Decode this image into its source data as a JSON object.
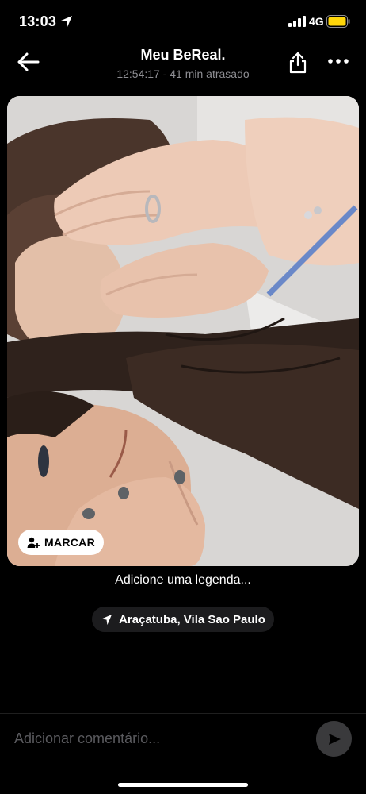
{
  "status_bar": {
    "time": "13:03",
    "network": "4G",
    "battery_color": "#ffd60a",
    "icons": [
      "location-arrow-icon",
      "signal-icon",
      "battery-icon"
    ]
  },
  "header": {
    "title": "Meu BeReal.",
    "subtitle": "12:54:17 - 41 min atrasado",
    "icons": [
      "back-arrow-icon",
      "share-icon",
      "more-icon"
    ]
  },
  "photo": {
    "tag_button_label": "MARCAR",
    "tag_icon": "add-person-icon"
  },
  "caption_placeholder": "Adicione uma legenda...",
  "location": {
    "label": "Araçatuba, Vila Sao Paulo",
    "icon": "location-arrow-icon"
  },
  "comment": {
    "placeholder": "Adicionar comentário...",
    "send_icon": "send-icon"
  },
  "colors": {
    "background": "#000000",
    "muted_text": "#8e8e93",
    "chip_bg": "#1c1c1e",
    "send_bg": "#3a3a3c"
  }
}
